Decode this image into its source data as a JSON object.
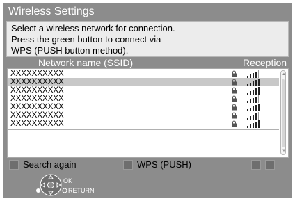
{
  "title": "Wireless Settings",
  "instructions": [
    "Select a wireless network for connection.",
    "Press the green button to connect via",
    "WPS (PUSH button method)."
  ],
  "columns": {
    "name": "Network name (SSID)",
    "reception": "Reception"
  },
  "networks": [
    {
      "ssid": "XXXXXXXXXX",
      "locked": true,
      "signal_bars": 4,
      "selected": false
    },
    {
      "ssid": "XXXXXXXXXX",
      "locked": true,
      "signal_bars": 5,
      "selected": true
    },
    {
      "ssid": "XXXXXXXXXX",
      "locked": true,
      "signal_bars": 5,
      "selected": false
    },
    {
      "ssid": "XXXXXXXXXX",
      "locked": true,
      "signal_bars": 4,
      "selected": false
    },
    {
      "ssid": "XXXXXXXXXX",
      "locked": true,
      "signal_bars": 5,
      "selected": false
    },
    {
      "ssid": "XXXXXXXXXX",
      "locked": true,
      "signal_bars": 4,
      "selected": false
    },
    {
      "ssid": "XXXXXXXXXX",
      "locked": true,
      "signal_bars": 5,
      "selected": false
    }
  ],
  "buttons": {
    "search_again": "Search again",
    "wps_push": "WPS (PUSH)"
  },
  "nav": {
    "ok": "OK",
    "return": "RETURN"
  },
  "colors": {
    "screen_bg": "#8c8c8c",
    "selected_row": "#c8c8c8",
    "color_button": "#6e6e6e"
  }
}
